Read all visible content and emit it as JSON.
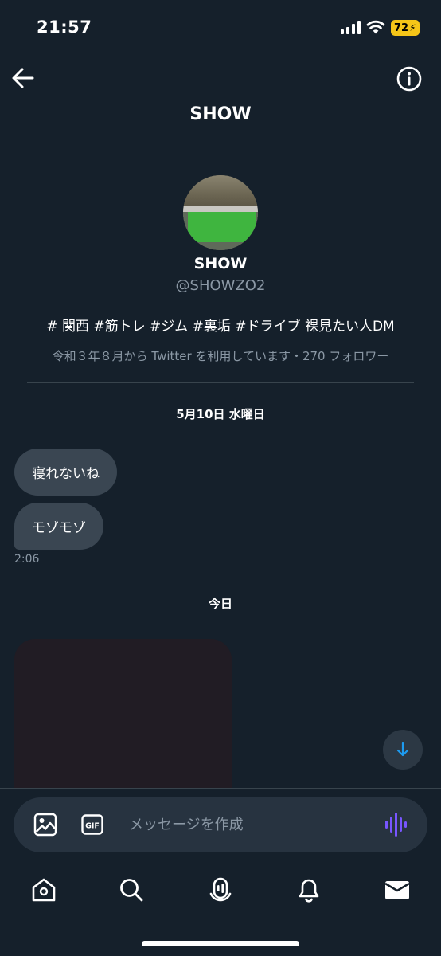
{
  "status_bar": {
    "time": "21:57",
    "battery": "72"
  },
  "header": {
    "title": "SHOW"
  },
  "profile": {
    "name": "SHOW",
    "handle": "@SHOWZO2",
    "bio": "# 関西 #筋トレ #ジム #裏垢 #ドライブ  裸見たい人DM",
    "meta": "令和３年８月から Twitter を利用しています・270 フォロワー"
  },
  "conversation": {
    "date_1": "5月10日 水曜日",
    "messages": [
      {
        "text": "寝れないね"
      },
      {
        "text": "モゾモゾ"
      }
    ],
    "message_time": "2:06",
    "date_2": "今日"
  },
  "composer": {
    "placeholder": "メッセージを作成",
    "gif_label": "GIF"
  },
  "tab_bar": {
    "items": [
      {
        "icon": "home-icon"
      },
      {
        "icon": "search-icon"
      },
      {
        "icon": "spaces-icon"
      },
      {
        "icon": "notifications-icon"
      },
      {
        "icon": "messages-icon"
      }
    ]
  },
  "colors": {
    "background": "#15202b",
    "bubble": "#3a4652",
    "muted_text": "#8b98a5",
    "accent_blue": "#1d9bf0",
    "voice_purple": "#7856ff",
    "battery": "#f5c518"
  }
}
